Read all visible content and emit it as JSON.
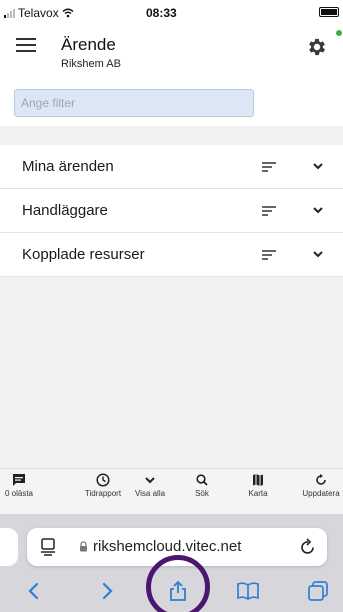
{
  "status_bar": {
    "carrier": "Telavox",
    "time": "08:33"
  },
  "header": {
    "title": "Ärende",
    "subtitle": "Rikshem AB"
  },
  "filter": {
    "placeholder": "Ange filter"
  },
  "list": {
    "items": [
      {
        "label": "Mina ärenden"
      },
      {
        "label": "Handläggare"
      },
      {
        "label": "Kopplade resurser"
      }
    ]
  },
  "toolbar": {
    "items": [
      {
        "label": "0 olästa",
        "icon": "message-icon"
      },
      {
        "label": "Tidrapport",
        "icon": "clock-icon"
      },
      {
        "label": "Visa alla",
        "icon": "chevron-down-icon"
      },
      {
        "label": "Sök",
        "icon": "search-icon"
      },
      {
        "label": "Karta",
        "icon": "map-icon"
      },
      {
        "label": "Uppdatera",
        "icon": "refresh-icon"
      }
    ]
  },
  "browser": {
    "url": "rikshemcloud.vitec.net"
  },
  "colors": {
    "accent": "#2f7ed8",
    "highlight_ring": "#4a1670",
    "filter_bg": "#dbe7f4",
    "online": "#3cb043"
  }
}
